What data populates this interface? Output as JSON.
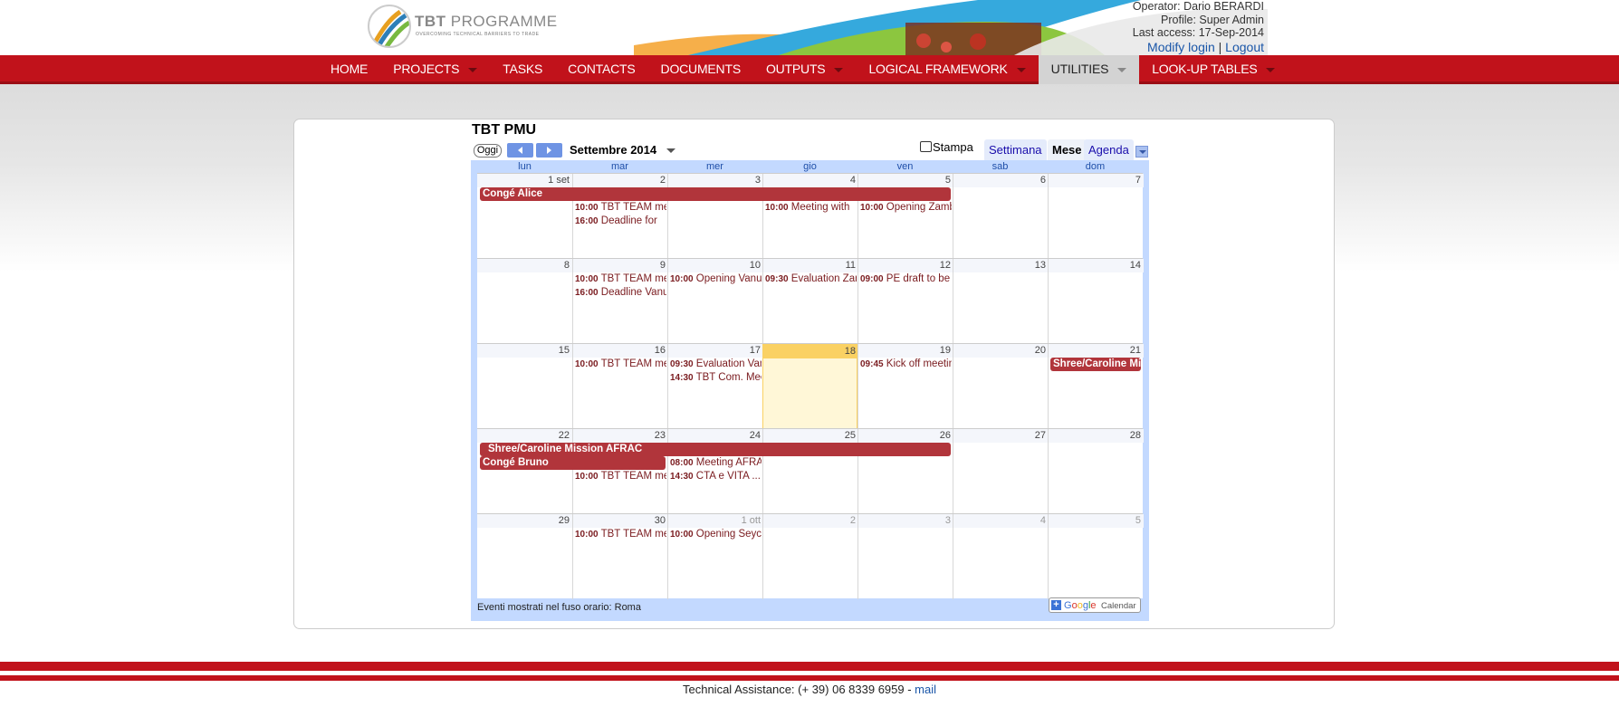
{
  "app": {
    "logo_title_bold": "TBT",
    "logo_title": "PROGRAMME",
    "logo_tagline": "OVERCOMING TECHNICAL BARRIERS TO TRADE"
  },
  "user": {
    "operator": "Operator: Dario BERARDI",
    "profile": "Profile: Super Admin",
    "last_access": "Last access: 17-Sep-2014",
    "modify_login": "Modify login",
    "separator": "|",
    "logout": "Logout"
  },
  "nav": [
    {
      "label": "HOME",
      "caret": false,
      "active": false
    },
    {
      "label": "PROJECTS",
      "caret": true,
      "active": false
    },
    {
      "label": "TASKS",
      "caret": false,
      "active": false
    },
    {
      "label": "CONTACTS",
      "caret": false,
      "active": false
    },
    {
      "label": "DOCUMENTS",
      "caret": false,
      "active": false
    },
    {
      "label": "OUTPUTS",
      "caret": true,
      "active": false
    },
    {
      "label": "LOGICAL FRAMEWORK",
      "caret": true,
      "active": false
    },
    {
      "label": "UTILITIES",
      "caret": true,
      "active": true
    },
    {
      "label": "LOOK-UP TABLES",
      "caret": true,
      "active": false
    }
  ],
  "calendar": {
    "title": "TBT PMU",
    "today_button": "Oggi",
    "month_label": "Settembre 2014",
    "print_label": "Stampa",
    "views": [
      "Settimana",
      "Mese",
      "Agenda"
    ],
    "selected_view": "Mese",
    "days_of_week": [
      "lun",
      "mar",
      "mer",
      "gio",
      "ven",
      "sab",
      "dom"
    ],
    "weeks": [
      {
        "days": [
          {
            "n": "1 set"
          },
          {
            "n": "2"
          },
          {
            "n": "3"
          },
          {
            "n": "4"
          },
          {
            "n": "5"
          },
          {
            "n": "6"
          },
          {
            "n": "7"
          }
        ],
        "bars": [
          {
            "title": "Congé Alice",
            "start": 0,
            "span": 5,
            "row": 0
          }
        ],
        "events": [
          {
            "day": 1,
            "row": 1,
            "time": "10:00",
            "title": "TBT TEAM meeting"
          },
          {
            "day": 1,
            "row": 2,
            "time": "16:00",
            "title": "Deadline for"
          },
          {
            "day": 3,
            "row": 1,
            "time": "10:00",
            "title": "Meeting with"
          },
          {
            "day": 4,
            "row": 1,
            "time": "10:00",
            "title": "Opening Zambia"
          }
        ]
      },
      {
        "days": [
          {
            "n": "8"
          },
          {
            "n": "9"
          },
          {
            "n": "10"
          },
          {
            "n": "11"
          },
          {
            "n": "12"
          },
          {
            "n": "13"
          },
          {
            "n": "14"
          }
        ],
        "bars": [],
        "events": [
          {
            "day": 1,
            "row": 0,
            "time": "10:00",
            "title": "TBT TEAM meeting"
          },
          {
            "day": 1,
            "row": 1,
            "time": "16:00",
            "title": "Deadline Vanuatu"
          },
          {
            "day": 2,
            "row": 0,
            "time": "10:00",
            "title": "Opening Vanuatu"
          },
          {
            "day": 3,
            "row": 0,
            "time": "09:30",
            "title": "Evaluation Zambia"
          },
          {
            "day": 4,
            "row": 0,
            "time": "09:00",
            "title": "PE draft to be"
          }
        ]
      },
      {
        "days": [
          {
            "n": "15"
          },
          {
            "n": "16"
          },
          {
            "n": "17"
          },
          {
            "n": "18",
            "today": true
          },
          {
            "n": "19"
          },
          {
            "n": "20"
          },
          {
            "n": "21"
          }
        ],
        "bars": [
          {
            "title": "Shree/Caroline Mission AFRAC",
            "start": 6,
            "span": 1,
            "row": 0
          }
        ],
        "events": [
          {
            "day": 1,
            "row": 0,
            "time": "10:00",
            "title": "TBT TEAM meeting"
          },
          {
            "day": 2,
            "row": 0,
            "time": "09:30",
            "title": "Evaluation Vanuatu"
          },
          {
            "day": 2,
            "row": 1,
            "time": "14:30",
            "title": "TBT Com. Meeting"
          },
          {
            "day": 4,
            "row": 0,
            "time": "09:45",
            "title": "Kick off meeting"
          }
        ]
      },
      {
        "days": [
          {
            "n": "22"
          },
          {
            "n": "23"
          },
          {
            "n": "24"
          },
          {
            "n": "25"
          },
          {
            "n": "26"
          },
          {
            "n": "27"
          },
          {
            "n": "28"
          }
        ],
        "bars": [
          {
            "title": "Shree/Caroline Mission AFRAC",
            "start": 0,
            "span": 5,
            "row": 0,
            "indent": true
          },
          {
            "title": "Congé Bruno",
            "start": 0,
            "span": 2,
            "row": 1
          }
        ],
        "events": [
          {
            "day": 2,
            "row": 1,
            "time": "08:00",
            "title": "Meeting AFRAC"
          },
          {
            "day": 1,
            "row": 2,
            "time": "10:00",
            "title": "TBT TEAM meeting"
          },
          {
            "day": 2,
            "row": 2,
            "time": "14:30",
            "title": "CTA e VITA ..."
          }
        ]
      },
      {
        "days": [
          {
            "n": "29"
          },
          {
            "n": "30"
          },
          {
            "n": "1 ott",
            "other": true
          },
          {
            "n": "2",
            "other": true
          },
          {
            "n": "3",
            "other": true
          },
          {
            "n": "4",
            "other": true
          },
          {
            "n": "5",
            "other": true
          }
        ],
        "bars": [],
        "events": [
          {
            "day": 1,
            "row": 0,
            "time": "10:00",
            "title": "TBT TEAM meeting"
          },
          {
            "day": 2,
            "row": 0,
            "time": "10:00",
            "title": "Opening Seychelles"
          }
        ]
      }
    ],
    "timezone_note": "Eventi mostrati nel fuso orario: Roma",
    "gcal_badge_google": "Google",
    "gcal_badge_calendar": "Calendar"
  },
  "footer": {
    "assistance": "Technical Assistance: (+ 39) 06 8339 6959 - ",
    "mail": "mail"
  },
  "colors": {
    "nav_red": "#c1121b",
    "event_bar": "#b1353b",
    "event_text": "#7a1b1f",
    "today": "#fad163"
  }
}
